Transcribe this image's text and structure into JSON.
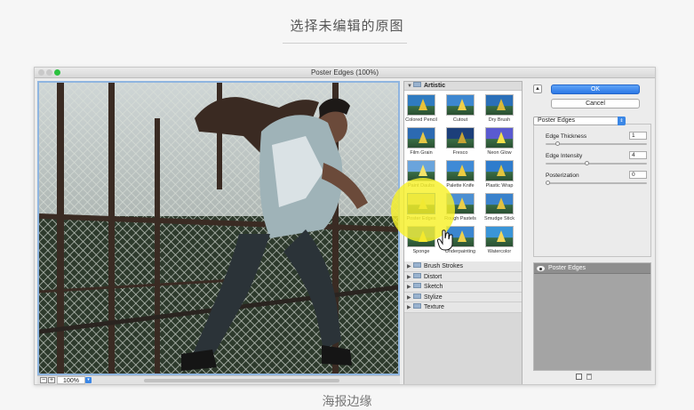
{
  "page": {
    "heading": "选择未编辑的原图",
    "bottom_caption": "海报边缘"
  },
  "window": {
    "title": "Poster Edges (100%)"
  },
  "preview": {
    "zoom_out": "−",
    "zoom_in": "+",
    "zoom_level": "100%"
  },
  "gallery": {
    "open_category": "Artistic",
    "filters": [
      {
        "label": "Colored Pencil"
      },
      {
        "label": "Cutout"
      },
      {
        "label": "Dry Brush"
      },
      {
        "label": "Film Grain"
      },
      {
        "label": "Fresco"
      },
      {
        "label": "Neon Glow"
      },
      {
        "label": "Paint Daubs"
      },
      {
        "label": "Palette Knife"
      },
      {
        "label": "Plastic Wrap"
      },
      {
        "label": "Poster Edges"
      },
      {
        "label": "Rough Pastels"
      },
      {
        "label": "Smudge Stick"
      },
      {
        "label": "Sponge"
      },
      {
        "label": "Underpainting"
      },
      {
        "label": "Watercolor"
      }
    ],
    "selected_filter": "Poster Edges",
    "categories": [
      "Brush Strokes",
      "Distort",
      "Sketch",
      "Stylize",
      "Texture"
    ]
  },
  "panel": {
    "ok_label": "OK",
    "cancel_label": "Cancel",
    "filter_select_value": "Poster Edges",
    "params": [
      {
        "label": "Edge Thickness",
        "value": "1",
        "slider_fraction": 0.1
      },
      {
        "label": "Edge Intensity",
        "value": "4",
        "slider_fraction": 0.4
      },
      {
        "label": "Posterization",
        "value": "0",
        "slider_fraction": 0.0
      }
    ],
    "effect_layer": "Poster Edges"
  },
  "colors": {
    "accent": "#2c78e6",
    "highlight": "#f7f028"
  }
}
